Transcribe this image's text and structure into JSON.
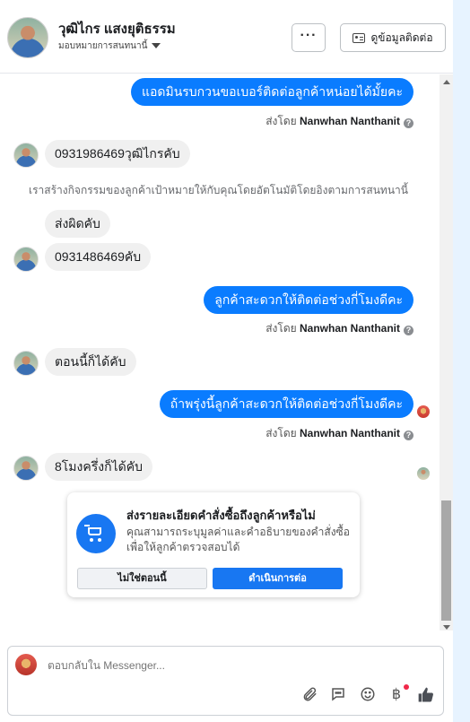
{
  "header": {
    "contact_name": "วุฒิไกร แสงยุติธรรม",
    "assign_label": "มอบหมายการสนทนานี้",
    "more_label": "···",
    "contact_info_label": "ดูข้อมูลติดต่อ"
  },
  "messages": [
    {
      "dir": "out",
      "text": "แอดมินรบกวนขอเบอร์ติดต่อลูกค้าหน่อยได้มั้ยคะ",
      "sent_by_prefix": "ส่งโดย",
      "sent_by": "Nanwhan Nanthanit"
    },
    {
      "dir": "in",
      "text": "0931986469วุฒิไกรคับ"
    },
    {
      "dir": "system",
      "text": "เราสร้างกิจกรรมของลูกค้าเป้าหมายให้กับคุณโดยอัตโนมัติโดยอิงตามการสนทนานี้"
    },
    {
      "dir": "in",
      "text": "ส่งผิดคับ"
    },
    {
      "dir": "in",
      "text": "0931486469คับ"
    },
    {
      "dir": "out",
      "text": "ลูกค้าสะดวกให้ติดต่อช่วงกี่โมงดีคะ",
      "sent_by_prefix": "ส่งโดย",
      "sent_by": "Nanwhan Nanthanit"
    },
    {
      "dir": "in",
      "text": "ตอนนี้ก็ได้คับ"
    },
    {
      "dir": "out",
      "text": "ถ้าพรุ่งนี้ลูกค้าสะดวกให้ติดต่อช่วงกี่โมงดีคะ",
      "sent_by_prefix": "ส่งโดย",
      "sent_by": "Nanwhan Nanthanit"
    },
    {
      "dir": "in",
      "text": "8โมงครึ่งก็ได้คับ"
    }
  ],
  "order_card": {
    "title": "ส่งรายละเอียดคำสั่งซื้อถึงลูกค้าหรือไม่",
    "description": "คุณสามารถระบุมูลค่าและคำอธิบายของคำสั่งซื้อเพื่อให้ลูกค้าตรวจสอบได้",
    "decline_label": "ไม่ใช่ตอนนี้",
    "proceed_label": "ดำเนินการต่อ"
  },
  "composer": {
    "placeholder": "ตอบกลับใน Messenger..."
  },
  "icons": {
    "attach": "paperclip-icon",
    "saved_replies": "chat-bubble-icon",
    "emoji": "smiley-icon",
    "payment": "baht-icon",
    "like": "thumbs-up-icon"
  },
  "colors": {
    "accent": "#0a7cff",
    "incoming_bubble": "#f0f0f0",
    "notification": "#f02849"
  }
}
